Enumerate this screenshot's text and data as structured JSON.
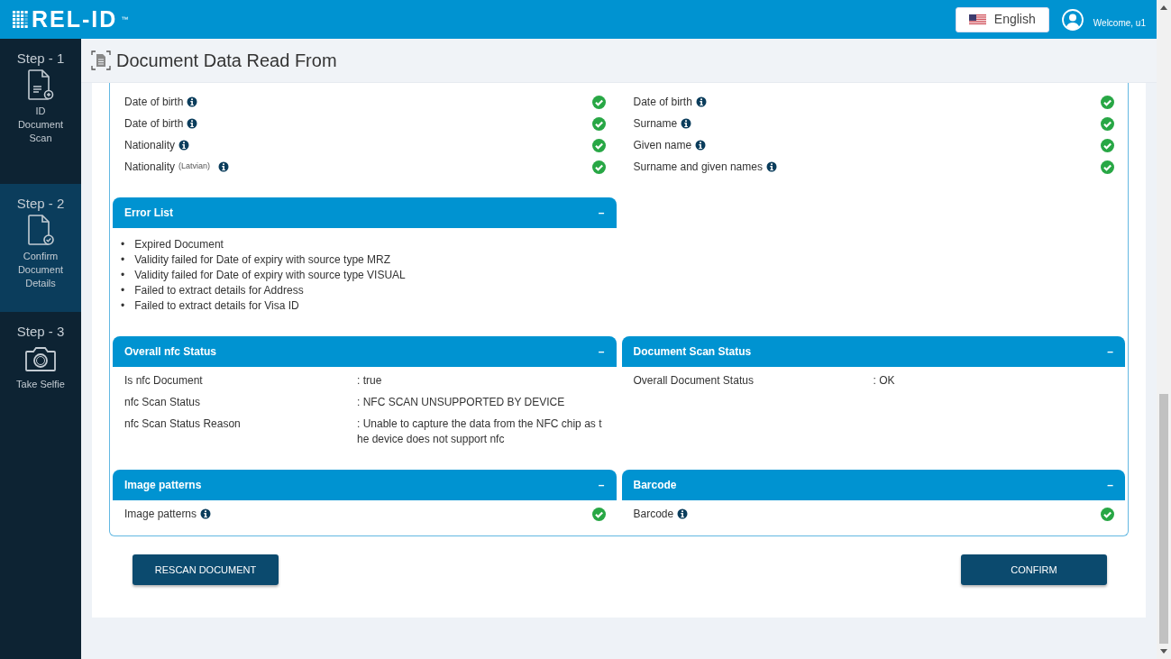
{
  "logo": {
    "text": "REL-ID",
    "mark": "™"
  },
  "language": {
    "label": "English"
  },
  "user": {
    "greeting": "Welcome, u1"
  },
  "steps": [
    {
      "step": "Step - 1",
      "label": "ID Document Scan",
      "kind": "document-add",
      "selected": false
    },
    {
      "step": "Step - 2",
      "label": "Confirm Document Details",
      "kind": "document-check",
      "selected": true
    },
    {
      "step": "Step - 3",
      "label": "Take Selfie",
      "kind": "camera",
      "selected": false
    }
  ],
  "page_title": "Document Data Read From",
  "checks": {
    "left": [
      {
        "label": "Date of birth",
        "ok": true
      },
      {
        "label": "Date of birth",
        "ok": true
      },
      {
        "label": "Nationality",
        "ok": true
      },
      {
        "label": "Nationality",
        "note": "(Latvian)",
        "ok": true
      }
    ],
    "right": [
      {
        "label": "Date of birth",
        "ok": true
      },
      {
        "label": "Surname",
        "ok": true
      },
      {
        "label": "Given name",
        "ok": true
      },
      {
        "label": "Surname and given names",
        "ok": true
      }
    ]
  },
  "error_list": {
    "title": "Error List",
    "toggle": "–",
    "items": [
      {
        "bullet": "•",
        "text": "Expired Document"
      },
      {
        "bullet": "•",
        "text": "Validity failed for Date of expiry with source type MRZ"
      },
      {
        "bullet": "•",
        "text": "Validity failed for Date of expiry with source type VISUAL"
      },
      {
        "bullet": "•",
        "text": "Failed to extract details for Address"
      },
      {
        "bullet": "•",
        "text": "Failed to extract details for Visa ID"
      }
    ]
  },
  "status_panels": [
    {
      "title": "Overall nfc Status",
      "toggle": "–",
      "kind": "fields",
      "fields": [
        {
          "key": "Is nfc Document",
          "value": ": true"
        },
        {
          "key": "nfc Scan Status",
          "value": ": NFC SCAN UNSUPPORTED BY DEVICE"
        },
        {
          "key": "nfc Scan Status Reason",
          "value": ": Unable to capture the data from the NFC chip as the device does not support nfc"
        }
      ]
    },
    {
      "title": "Document Scan Status",
      "toggle": "–",
      "kind": "fields",
      "fields": [
        {
          "key": "Overall Document Status",
          "value": ": OK"
        }
      ]
    }
  ],
  "check_panels": [
    {
      "title": "Image patterns",
      "toggle": "–",
      "kind": "checks",
      "checks": [
        {
          "label": "Image patterns",
          "ok": true
        }
      ]
    },
    {
      "title": "Barcode",
      "toggle": "–",
      "kind": "checks",
      "checks": [
        {
          "label": "Barcode",
          "ok": true
        }
      ]
    }
  ],
  "buttons": [
    {
      "label": "RESCAN DOCUMENT"
    },
    {
      "label": "CONFIRM"
    }
  ]
}
